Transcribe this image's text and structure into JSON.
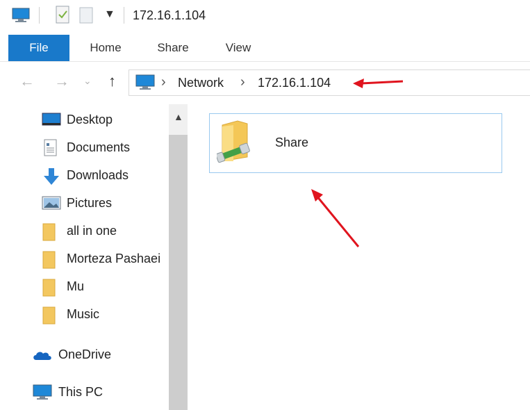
{
  "window": {
    "title": "172.16.1.104"
  },
  "ribbon": {
    "tabs": [
      "File",
      "Home",
      "Share",
      "View"
    ]
  },
  "address": {
    "crumbs": [
      "Network",
      "172.16.1.104"
    ]
  },
  "nav": {
    "quick_access": [
      {
        "label": "Desktop",
        "icon": "desktop-icon",
        "pinned": true
      },
      {
        "label": "Documents",
        "icon": "documents-icon",
        "pinned": true
      },
      {
        "label": "Downloads",
        "icon": "downloads-icon",
        "pinned": true
      },
      {
        "label": "Pictures",
        "icon": "pictures-icon",
        "pinned": true
      },
      {
        "label": "all in one",
        "icon": "folder-icon",
        "pinned": false
      },
      {
        "label": "Morteza Pashaei",
        "icon": "folder-icon",
        "pinned": false
      },
      {
        "label": "Mu",
        "icon": "folder-icon",
        "pinned": false
      },
      {
        "label": "Music",
        "icon": "folder-icon",
        "pinned": false
      }
    ],
    "onedrive": "OneDrive",
    "this_pc": "This PC"
  },
  "content": {
    "items": [
      {
        "label": "Share",
        "icon": "network-share-folder-icon"
      }
    ]
  },
  "colors": {
    "accent": "#1979ca",
    "annotation_arrow": "#e0141e",
    "selection_border": "#99c9ef"
  }
}
